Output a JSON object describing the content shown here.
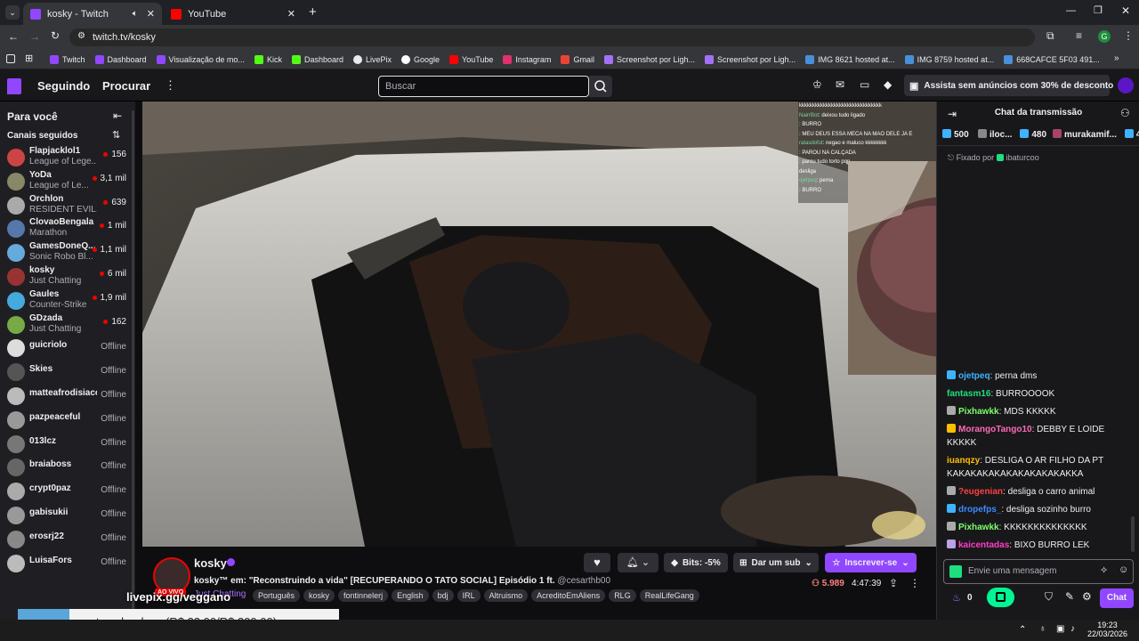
{
  "browser": {
    "tabs": [
      {
        "title": "kosky - Twitch",
        "active": true
      },
      {
        "title": "YouTube",
        "active": false
      }
    ],
    "url": "twitch.tv/kosky",
    "bookmarks": [
      "Twitch",
      "Dashboard",
      "Visualização de mo...",
      "Kick",
      "Dashboard",
      "LivePix",
      "Google",
      "YouTube",
      "Instagram",
      "Gmail",
      "Screenshot por Ligh...",
      "Screenshot por Ligh...",
      "IMG 8621 hosted at...",
      "IMG 8759 hosted at...",
      "668CAFCE 5F03 491..."
    ],
    "profile_initial": "G"
  },
  "twitch": {
    "nav": {
      "following": "Seguindo",
      "browse": "Procurar",
      "search_placeholder": "Buscar",
      "prime_text": "Assista sem anúncios com 30% de desconto"
    },
    "sidebar": {
      "title": "Para você",
      "section": "Canais seguidos",
      "channels": [
        {
          "name": "Flapjacklol1",
          "game": "League of Lege...",
          "viewers": "156",
          "live": true
        },
        {
          "name": "YoDa",
          "game": "League of Le...",
          "viewers": "3,1 mil",
          "live": true
        },
        {
          "name": "Orchlon",
          "game": "RESIDENT EVIL...",
          "viewers": "639",
          "live": true
        },
        {
          "name": "ClovaoBengala",
          "game": "Marathon",
          "viewers": "1 mil",
          "live": true
        },
        {
          "name": "GamesDoneQ...",
          "game": "Sonic Robo Bl...",
          "viewers": "1,1 mil",
          "live": true
        },
        {
          "name": "kosky",
          "game": "Just Chatting",
          "viewers": "6 mil",
          "live": true
        },
        {
          "name": "Gaules",
          "game": "Counter-Strike",
          "viewers": "1,9 mil",
          "live": true
        },
        {
          "name": "GDzada",
          "game": "Just Chatting",
          "viewers": "162",
          "live": true
        },
        {
          "name": "guicriolo",
          "status": "Offline",
          "live": false
        },
        {
          "name": "Skies",
          "status": "Offline",
          "live": false
        },
        {
          "name": "matteafrodisiaco",
          "status": "Offline",
          "live": false
        },
        {
          "name": "pazpeaceful",
          "status": "Offline",
          "live": false
        },
        {
          "name": "013lcz",
          "status": "Offline",
          "live": false
        },
        {
          "name": "braiaboss",
          "status": "Offline",
          "live": false
        },
        {
          "name": "crypt0paz",
          "status": "Offline",
          "live": false
        },
        {
          "name": "gabisukii",
          "status": "Offline",
          "live": false
        },
        {
          "name": "erosrj22",
          "status": "Offline",
          "live": false
        },
        {
          "name": "LuisaFors",
          "status": "Offline",
          "live": false
        }
      ]
    },
    "stream": {
      "streamer": "kosky",
      "title": "kosky™ em: \"Reconstruindo a vida\" [RECUPERANDO O TATO SOCIAL] Episódio 1 ft.",
      "mention": "@cesarthb00",
      "category": "Just Chatting",
      "live_badge": "AO VIVO",
      "tags": [
        "Português",
        "kosky",
        "fontinnelerj",
        "English",
        "bdj",
        "IRL",
        "Altruismo",
        "AcreditoEmAliens",
        "RLG",
        "RealLifeGang"
      ],
      "viewers": "5.989",
      "uptime": "4:47:39",
      "bits_label": "Bits: -5%",
      "gift_label": "Dar um sub",
      "subscribe_label": "Inscrever-se",
      "overlay_url": "livepix.gg/veggano",
      "donation_text": "contas obg dogs (R$ 32,00/R$ 200,00)",
      "overlay_chat_lines": [
        {
          "user": "",
          "text": "kkkkkkkkkkkkkkkkkkkkkkkkkkkkkkk"
        },
        {
          "user": "NairrBot",
          "text": ": deixou tudo ligado"
        },
        {
          "user": "",
          "text": ": BURRO"
        },
        {
          "user": "",
          "text": ": MEU DEUS ESSA MECA NA MAO DELE JA E"
        },
        {
          "user": "ratasdofut",
          "text": ": negao e maluco kkkkkkkk"
        },
        {
          "user": "",
          "text": ": PAROU NA CALÇADA"
        },
        {
          "user": "",
          "text": ": parou tudo torto pqp"
        },
        {
          "user": "",
          "text": "desliga"
        },
        {
          "user": "ojetpeq",
          "text": ": perna"
        },
        {
          "user": "",
          "text": ": BURRO"
        }
      ]
    },
    "chat": {
      "header": "Chat da transmissão",
      "leaderboard": [
        {
          "value": "500",
          "name": ""
        },
        {
          "value": "480",
          "name": "iloc..."
        },
        {
          "value": "4",
          "name": "murakamif..."
        }
      ],
      "pinned": "Fixado por",
      "pinned_user": "ibaturcoo",
      "messages": [
        {
          "user": "ojetpeq",
          "color": "#3eb3ff",
          "text": "perna dms"
        },
        {
          "user": "fantasm16",
          "color": "#1edf7f",
          "text": "BURROOOOK"
        },
        {
          "user": "Pixhawkk",
          "color": "#7dff6c",
          "text": "MDS KKKKK"
        },
        {
          "user": "MorangoTango10",
          "color": "#ff69b4",
          "text": "DEBBY E LOIDE KKKKK"
        },
        {
          "user": "iuanqzy",
          "color": "#ffbf00",
          "text": "DESLIGA O AR FILHO DA PT KAKAKAKAKAKAKAKAKAKAKKA"
        },
        {
          "user": "?eugenian",
          "color": "#ff4040",
          "text": "desliga o carro animal"
        },
        {
          "user": "dropefps_",
          "color": "#3b8bff",
          "text": "desliga sozinho burro"
        },
        {
          "user": "Pixhawkk",
          "color": "#7dff6c",
          "text": "KKKKKKKKKKKKKK"
        },
        {
          "user": "kaicentadas",
          "color": "#ff3ec5",
          "text": "BIXO BURRO LEK"
        }
      ],
      "input_placeholder": "Envie uma mensagem",
      "points": "0",
      "chat_button": "Chat"
    }
  },
  "taskbar": {
    "time": "19:23",
    "date": "22/03/2026"
  },
  "colors": {
    "twitch_purple": "#9147ff",
    "live_red": "#eb0400",
    "bg": "#0e0e10"
  }
}
